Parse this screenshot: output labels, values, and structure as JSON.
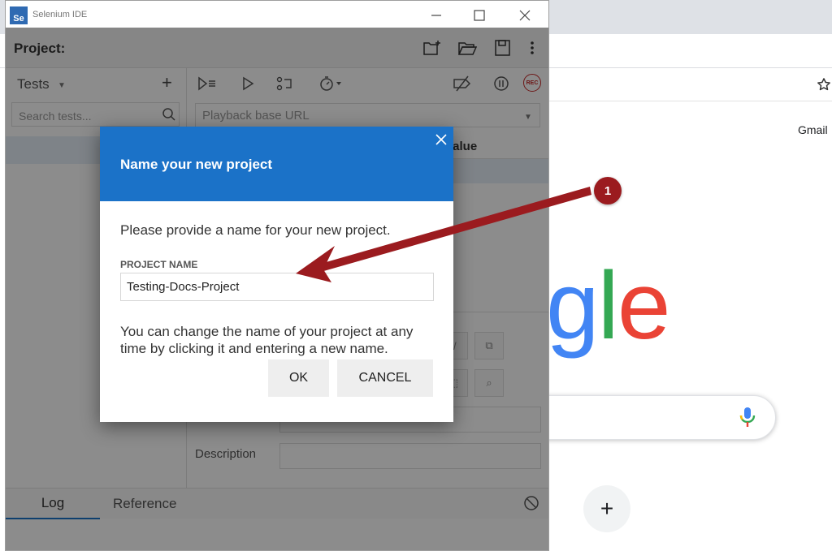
{
  "ide": {
    "app_title": "Selenium IDE",
    "logo_text": "Se",
    "project_label": "Project:",
    "tests_label": "Tests",
    "search_placeholder": "Search tests...",
    "url_placeholder": "Playback base URL",
    "value_column": "Value",
    "rec_label": "REC",
    "description_label": "Description",
    "tab_log": "Log",
    "tab_reference": "Reference"
  },
  "dialog": {
    "title": "Name your new project",
    "prompt": "Please provide a name for your new project.",
    "field_label": "PROJECT NAME",
    "field_value": "Testing-Docs-Project",
    "hint": "You can change the name of your project at any time by clicking it and entering a new name.",
    "ok_label": "OK",
    "cancel_label": "CANCEL"
  },
  "browser": {
    "gmail_link": "Gmail",
    "logo_fragment": [
      "g",
      "l",
      "e"
    ],
    "logo_colors": [
      "#4285f4",
      "#34a853",
      "#ea4335"
    ],
    "shortcut_label": "+"
  },
  "annotation": {
    "badge": "1",
    "color": "#9b1b1f"
  },
  "colors": {
    "dialog_header": "#1b72c8",
    "rec": "#c62828",
    "tab_underline": "#1a73c8"
  }
}
